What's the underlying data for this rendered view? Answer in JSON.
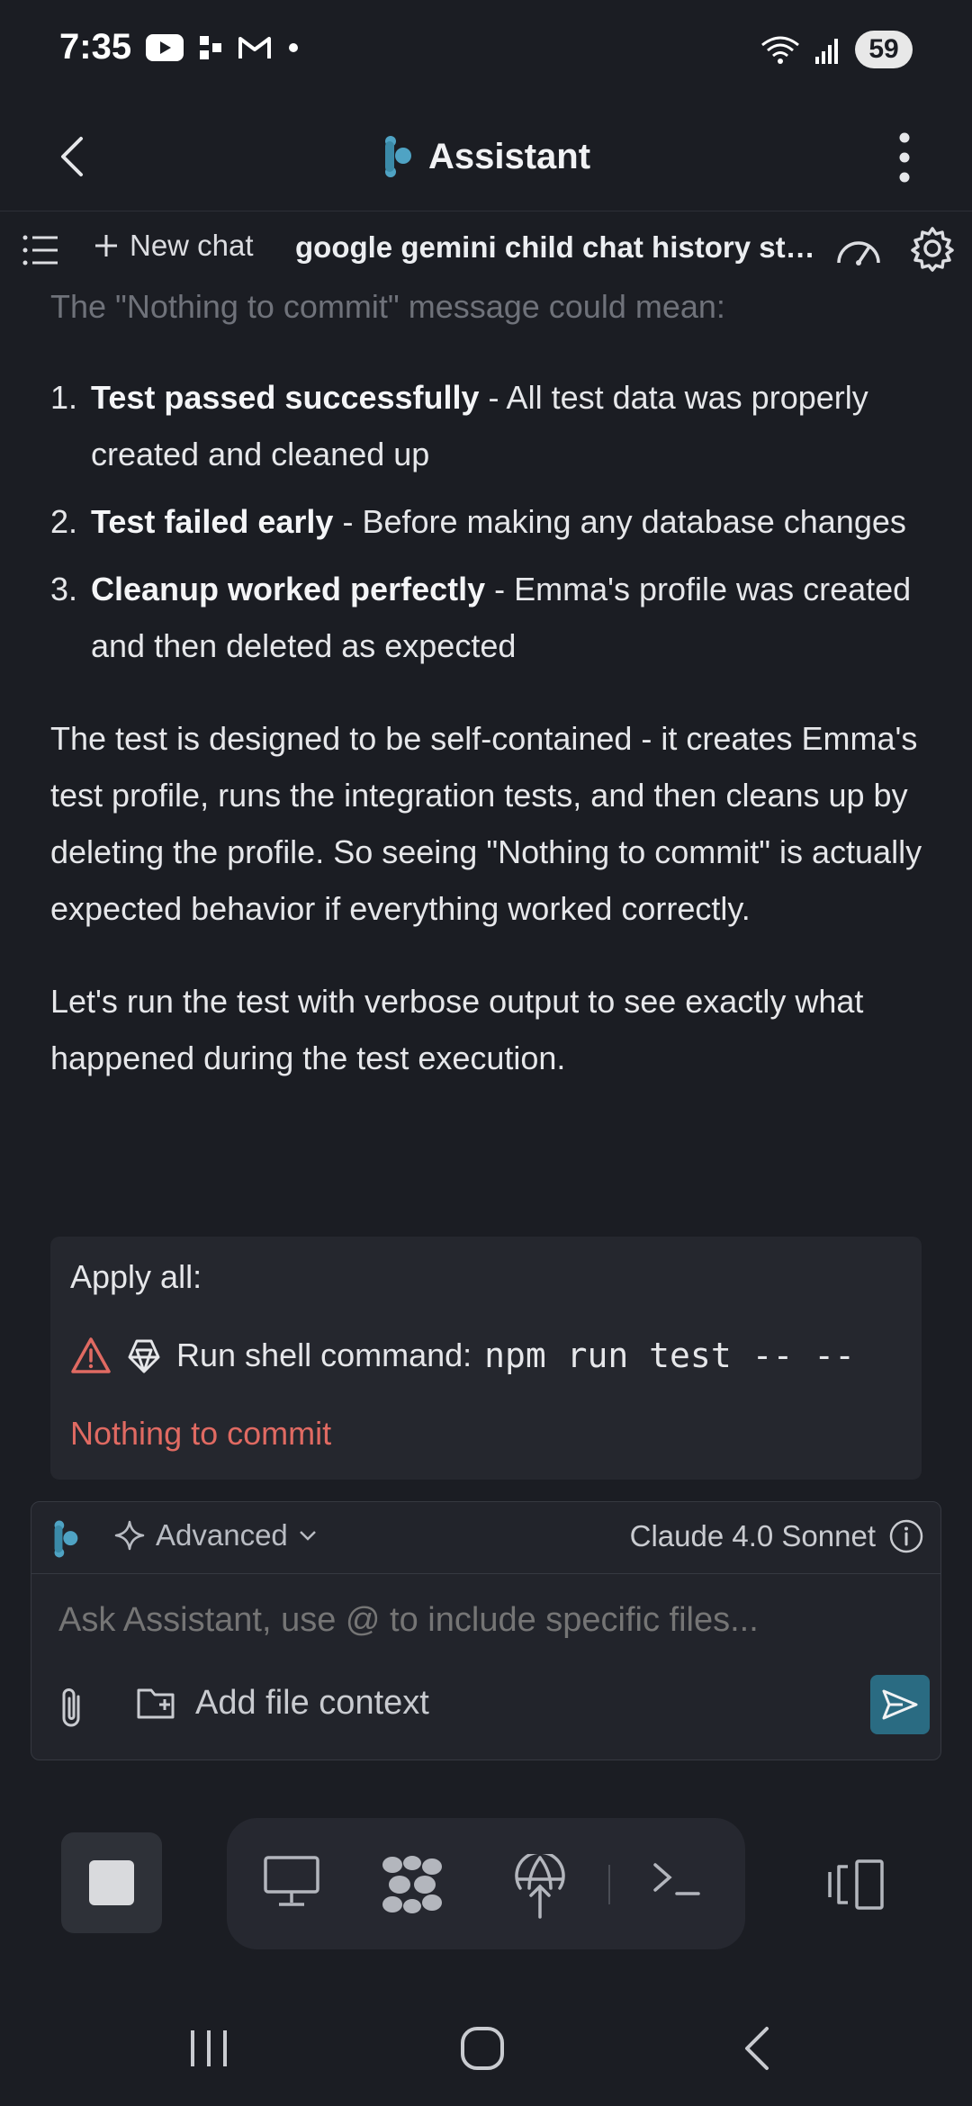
{
  "status_bar": {
    "time": "7:35",
    "battery": "59",
    "left_icons": [
      "youtube-icon",
      "app-icon",
      "gmail-icon",
      "dot-icon"
    ],
    "right_icons": [
      "wifi-icon",
      "signal-icon",
      "battery-icon"
    ]
  },
  "header": {
    "title": "Assistant"
  },
  "toolbar": {
    "new_chat_label": "New chat",
    "chat_title": "google gemini child chat history sto..."
  },
  "content": {
    "faded_line": "The \"Nothing to commit\" message could mean:",
    "reasons": [
      {
        "num": "1.",
        "bold": "Test passed successfully",
        "rest": " - All test data was properly created and cleaned up"
      },
      {
        "num": "2.",
        "bold": "Test failed early",
        "rest": " - Before making any database changes"
      },
      {
        "num": "3.",
        "bold": "Cleanup worked perfectly",
        "rest": " - Emma's profile was created and then deleted as expected"
      }
    ],
    "paragraph1": "The test is designed to be self-contained - it creates Emma's test profile, runs the integration tests, and then cleans up by deleting the profile. So seeing \"Nothing to commit\" is actually expected behavior if everything worked correctly.",
    "paragraph2": "Let's run the test with verbose output to see exactly what happened during the test execution."
  },
  "apply": {
    "label": "Apply all:",
    "command_label": "Run shell command:",
    "command": "npm run test -- --",
    "status": "Nothing to commit"
  },
  "composer": {
    "mode": "Advanced",
    "model": "Claude 4.0 Sonnet",
    "placeholder": "Ask Assistant, use @ to include specific files...",
    "add_context": "Add file context"
  },
  "colors": {
    "background": "#1b1d23",
    "accent": "#2a6b82",
    "error": "#e06a62",
    "brand": "#4fa3c4"
  }
}
